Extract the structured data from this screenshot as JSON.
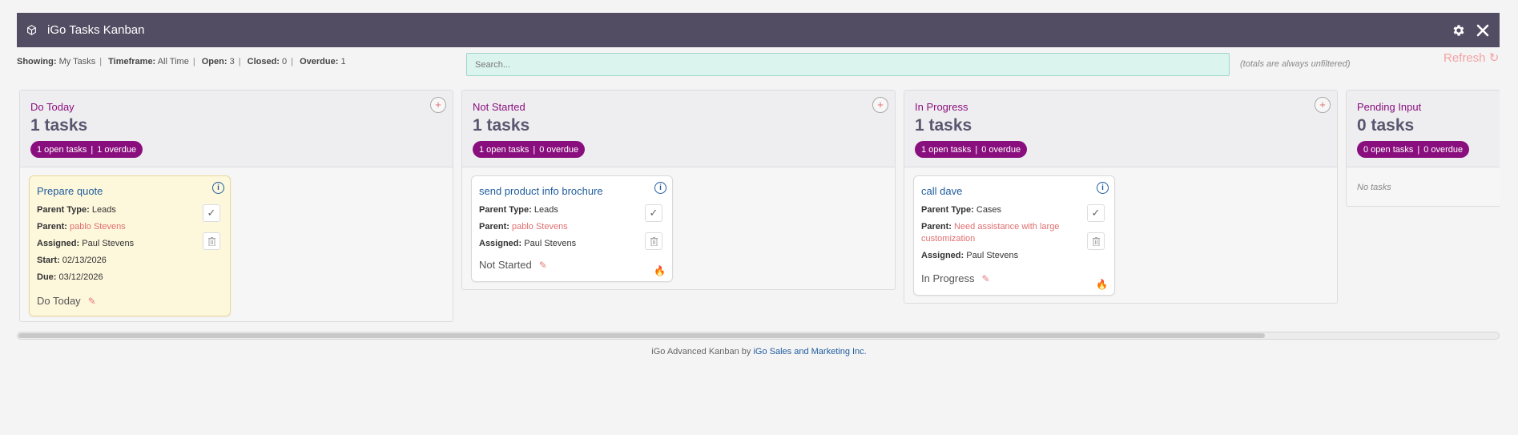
{
  "window": {
    "title": "iGo Tasks Kanban"
  },
  "stats": {
    "showing_label": "Showing:",
    "showing_value": "My Tasks",
    "timeframe_label": "Timeframe:",
    "timeframe_value": "All Time",
    "open_label": "Open:",
    "open_value": "3",
    "closed_label": "Closed:",
    "closed_value": "0",
    "overdue_label": "Overdue:",
    "overdue_value": "1"
  },
  "search": {
    "placeholder": "Search..."
  },
  "totals_note": "(totals are always unfiltered)",
  "refresh_label": "Refresh ↻",
  "columns": [
    {
      "name": "Do Today",
      "count": "1 tasks",
      "open": "1 open tasks",
      "overdue": "1 overdue",
      "card": {
        "title": "Prepare quote",
        "parent_type_label": "Parent Type:",
        "parent_type": "Leads",
        "parent_label": "Parent:",
        "parent": "pablo Stevens",
        "assigned_label": "Assigned:",
        "assigned": "Paul Stevens",
        "start_label": "Start:",
        "start": "02/13/2026",
        "due_label": "Due:",
        "due": "03/12/2026",
        "status": "Do Today"
      }
    },
    {
      "name": "Not Started",
      "count": "1 tasks",
      "open": "1 open tasks",
      "overdue": "0 overdue",
      "card": {
        "title": "send product info brochure",
        "parent_type_label": "Parent Type:",
        "parent_type": "Leads",
        "parent_label": "Parent:",
        "parent": "pablo Stevens",
        "assigned_label": "Assigned:",
        "assigned": "Paul Stevens",
        "status": "Not Started"
      }
    },
    {
      "name": "In Progress",
      "count": "1 tasks",
      "open": "1 open tasks",
      "overdue": "0 overdue",
      "card": {
        "title": "call dave",
        "parent_type_label": "Parent Type:",
        "parent_type": "Cases",
        "parent_label": "Parent:",
        "parent": "Need assistance with large customization",
        "assigned_label": "Assigned:",
        "assigned": "Paul Stevens",
        "status": "In Progress"
      }
    },
    {
      "name": "Pending Input",
      "count": "0 tasks",
      "open": "0 open tasks",
      "overdue": "0 overdue",
      "empty": "No tasks"
    }
  ],
  "add_symbol": "+",
  "info_symbol": "i",
  "check_symbol": "✓",
  "pill_separator": "|",
  "footer": {
    "text": "iGo Advanced Kanban by ",
    "link": "iGo Sales and Marketing Inc."
  },
  "colors": {
    "titlebar": "#534d64",
    "accent": "#8a0f7e",
    "link": "#1f5c9e",
    "parent_link": "#e16f6f"
  }
}
